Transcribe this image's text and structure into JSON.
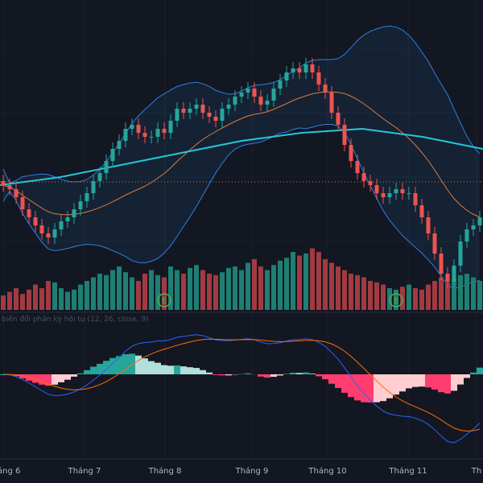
{
  "macd_pane": {
    "title": "biến đổi phân kỳ hội tụ (12, 26, close, 9)"
  },
  "time_axis": {
    "labels": [
      "Tháng 6",
      "Tháng 7",
      "Tháng 8",
      "Tháng 9",
      "Tháng 10",
      "Tháng 11",
      "Th"
    ]
  },
  "colors": {
    "background": "#131722",
    "up": "#26a69a",
    "down": "#ef5350",
    "volume_up": "#1e7f73",
    "volume_down": "#a23a42",
    "bollinger": "#2f7fe0",
    "ma_short": "#e07b39",
    "ma_long": "#26c6da",
    "macd": "#2962ff",
    "signal": "#ff6d00",
    "hist_pos_up": "#26a69a",
    "hist_pos_down": "#b2dfdb",
    "hist_neg_down": "#ff3d70",
    "hist_neg_up": "#ffcdd2",
    "reference_line": "#e07b39",
    "event_marker": "#4caf50"
  },
  "chart_data": {
    "type": "candlestick",
    "title": "",
    "x_ticks": [
      "Tháng 6",
      "Tháng 7",
      "Tháng 8",
      "Tháng 9",
      "Tháng 10",
      "Tháng 11",
      "Th"
    ],
    "close": [
      17,
      16.5,
      15.5,
      14,
      13,
      12,
      11,
      10.5,
      11.5,
      12.5,
      13,
      14,
      15,
      16,
      17.5,
      18.5,
      20,
      21.5,
      22.5,
      24,
      24.5,
      23.5,
      23,
      23,
      24,
      23.5,
      25,
      26.5,
      26,
      26.5,
      27,
      26,
      25.5,
      25,
      26.5,
      27,
      28,
      28.5,
      29,
      28,
      27,
      27.5,
      29,
      30,
      31,
      31.5,
      31,
      32,
      31,
      29.5,
      28.5,
      26,
      24.5,
      22,
      20,
      18.5,
      17.5,
      17,
      16,
      15.5,
      16,
      16.5,
      16,
      16,
      14.5,
      13,
      11,
      8.5,
      6,
      5,
      7,
      10,
      11.5,
      12,
      13
    ],
    "volume": [
      20,
      25,
      30,
      22,
      28,
      35,
      30,
      40,
      38,
      30,
      25,
      28,
      35,
      40,
      45,
      50,
      48,
      55,
      60,
      52,
      45,
      40,
      50,
      55,
      48,
      45,
      60,
      55,
      50,
      58,
      62,
      55,
      50,
      48,
      52,
      58,
      60,
      55,
      65,
      70,
      60,
      55,
      62,
      68,
      72,
      80,
      75,
      78,
      85,
      80,
      70,
      65,
      60,
      55,
      50,
      48,
      45,
      40,
      38,
      35,
      30,
      28,
      32,
      35,
      30,
      28,
      35,
      40,
      45,
      38,
      42,
      48,
      50,
      45,
      40
    ],
    "ma_long": [
      17,
      18,
      19.5,
      21,
      22.5,
      23.5,
      24,
      23,
      21.5
    ],
    "indicators": [
      "Bollinger Bands (20)",
      "MA (20)",
      "MA (long)",
      "Volume",
      "MACD (12, 26, close, 9)"
    ],
    "reference_level": 17.4,
    "event_markers": [
      {
        "label": "E",
        "index": 25
      },
      {
        "label": "E",
        "index": 61
      }
    ],
    "grid": true,
    "legend": "none"
  }
}
